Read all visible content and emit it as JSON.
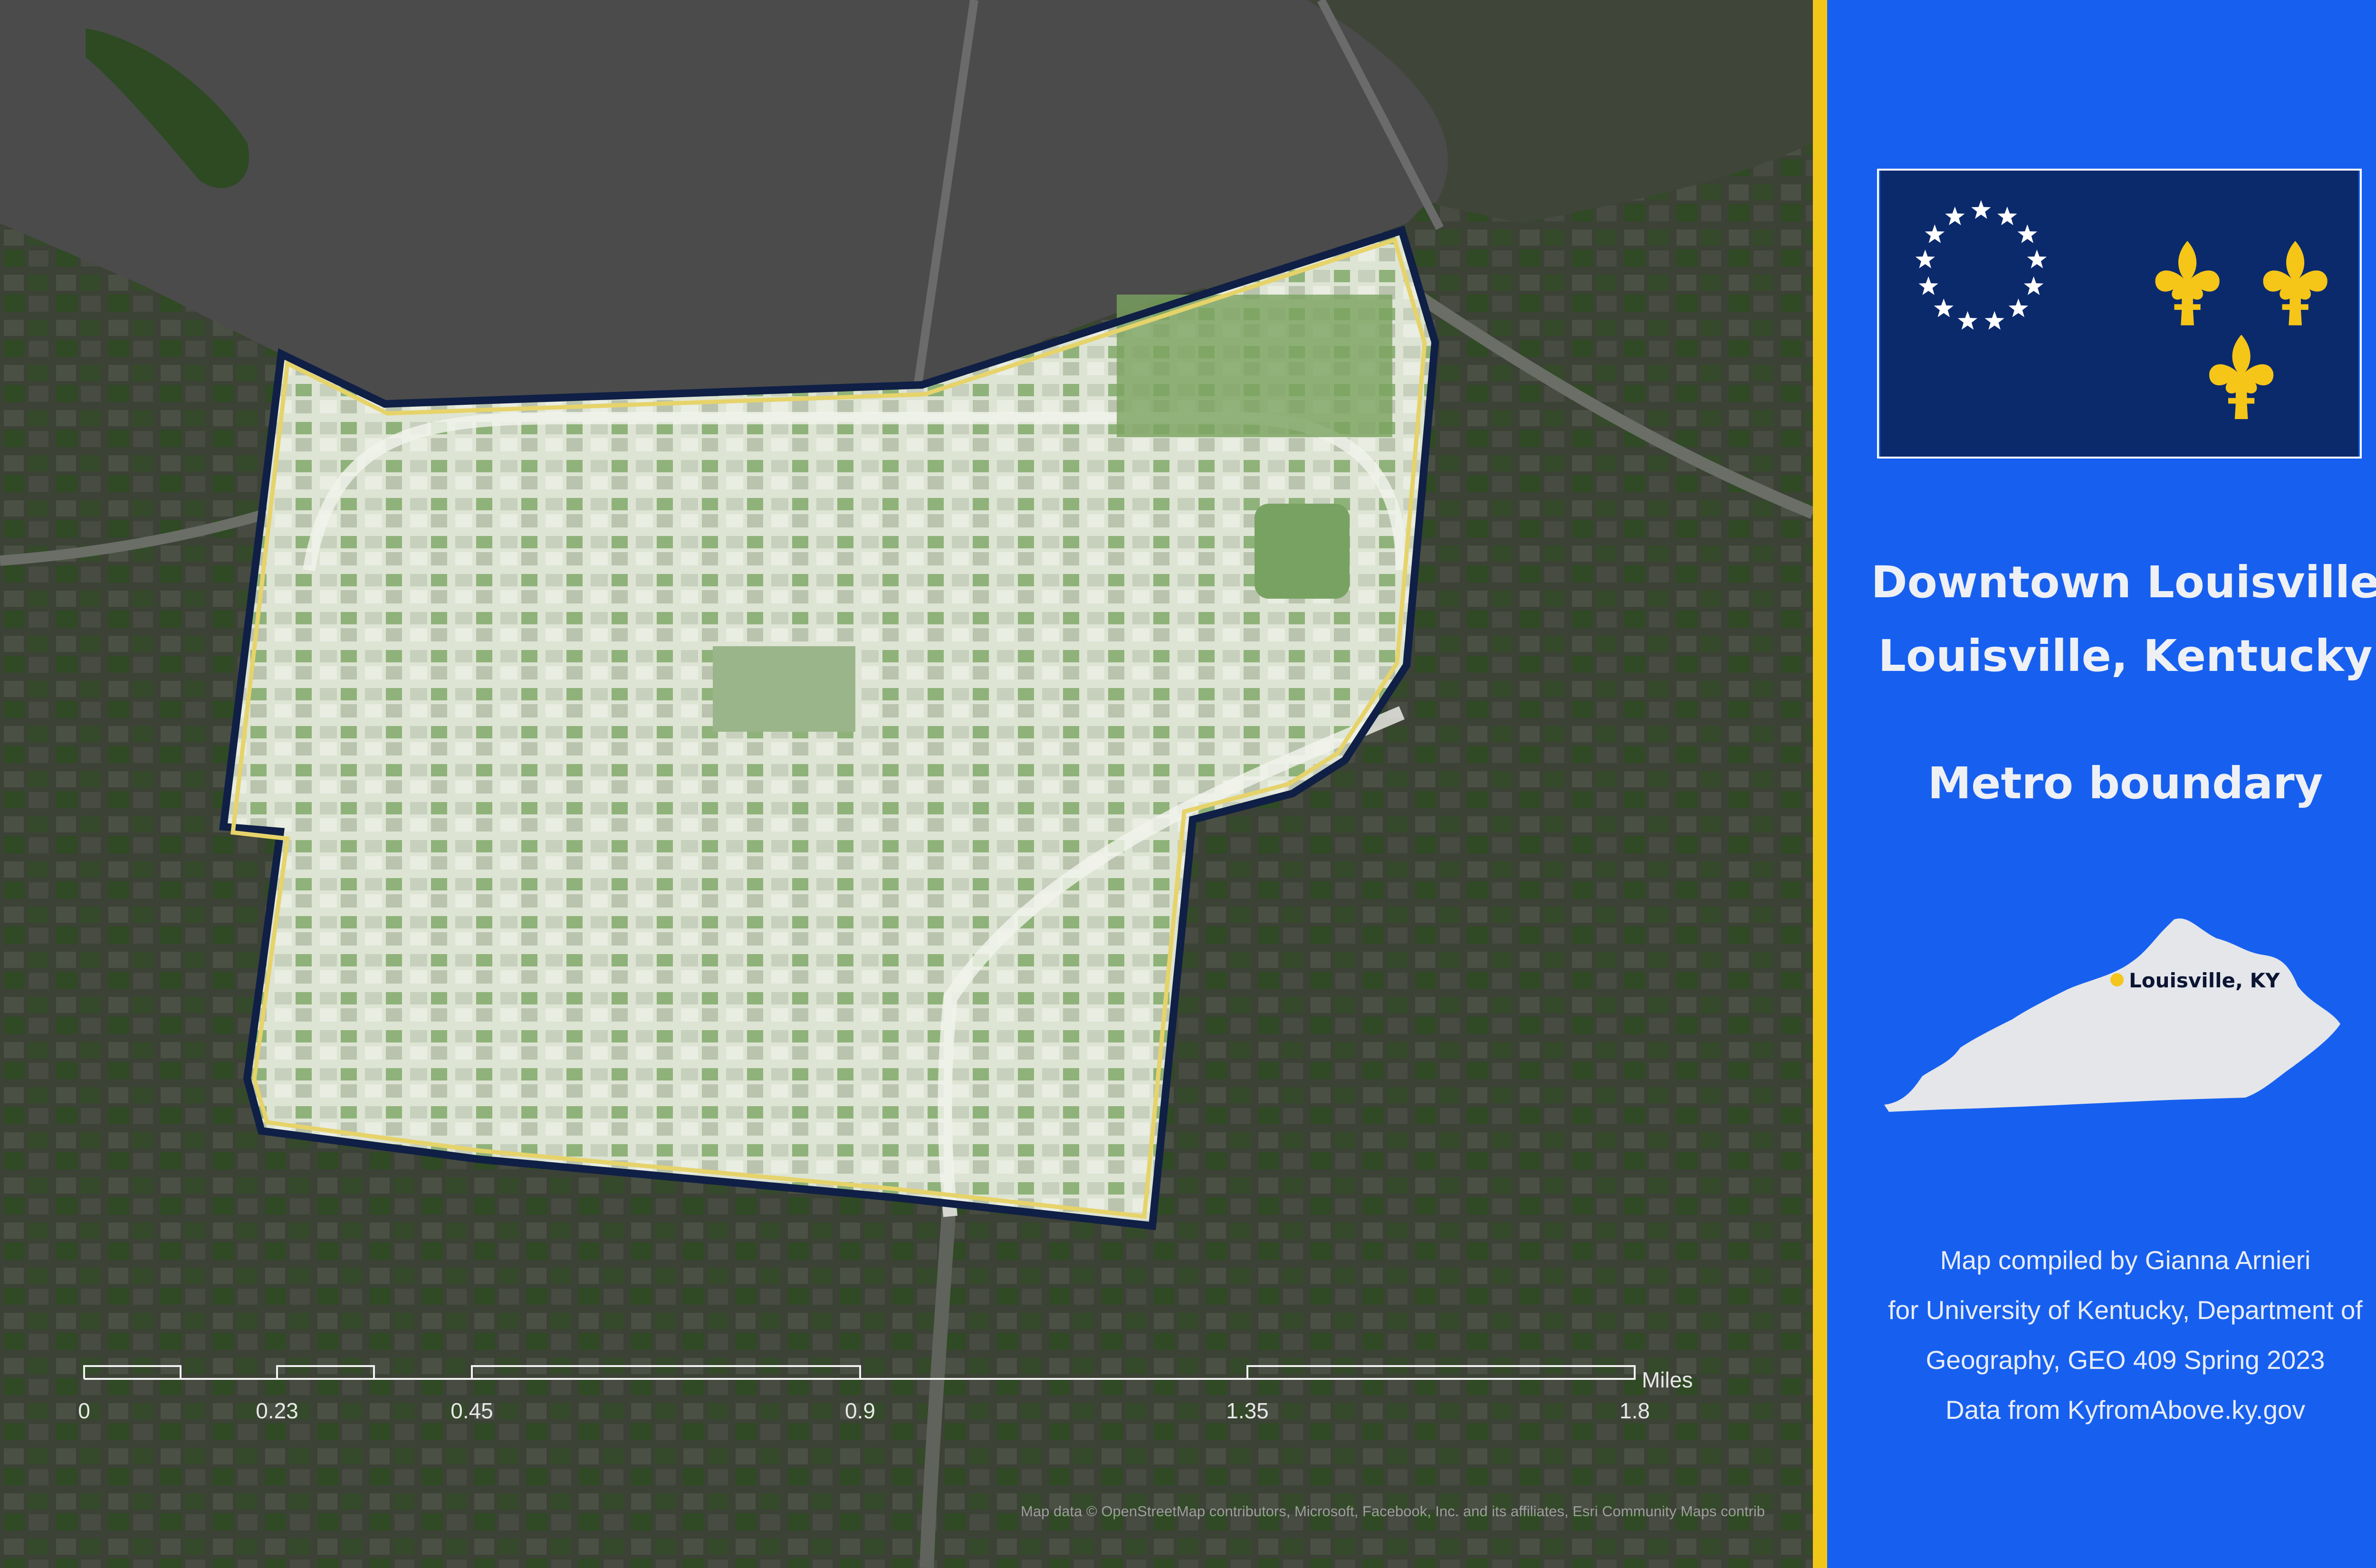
{
  "map": {
    "basemap": "grayscale hillshade imagery with green vegetation",
    "boundary_stroke_color": "#0f1f45",
    "boundary_inner_color": "#e6d36a",
    "highlight_fill_color": "#d8e3c9",
    "attribution": "Map data © OpenStreetMap contributors, Microsoft, Facebook, Inc. and its affiliates, Esri Community Maps contrib"
  },
  "scale_bar": {
    "unit": "Miles",
    "ticks": [
      "0",
      "0.23",
      "0.45",
      "0.9",
      "1.35",
      "1.8"
    ]
  },
  "side_panel": {
    "background_color": "#1760ef",
    "divider_color": "#f2c619",
    "flag": {
      "name": "Flag of Louisville",
      "field_color": "#0b2a6c",
      "star_color": "#ffffff",
      "emblem_color": "#f5c518",
      "star_count": 13,
      "emblem_count": 3
    },
    "title_line1": "Downtown Louisville",
    "title_line2": "Louisville, Kentucky",
    "subtitle": "Metro boundary",
    "inset": {
      "label": "Louisville, KY",
      "state_fill": "#e4e6ea",
      "marker_color": "#f4c51c"
    },
    "credits": {
      "line1": "Map compiled by Gianna Arnieri",
      "line2": "for University of Kentucky, Department of",
      "line3": "Geography, GEO 409 Spring 2023",
      "line4": "Data from KyfromAbove.ky.gov"
    }
  }
}
